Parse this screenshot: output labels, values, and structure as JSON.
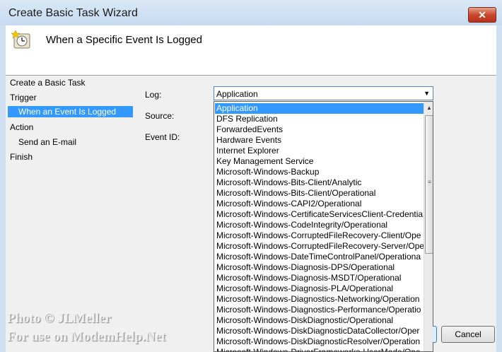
{
  "window": {
    "title": "Create Basic Task Wizard",
    "close_label": "✕"
  },
  "header": {
    "title": "When a Specific Event Is Logged",
    "icon": "scheduled-task-clock-icon"
  },
  "steps": [
    {
      "label": "Create a Basic Task",
      "selected": false,
      "indent": false
    },
    {
      "label": "Trigger",
      "selected": false,
      "indent": false
    },
    {
      "label": "When an Event Is Logged",
      "selected": true,
      "indent": true
    },
    {
      "label": "Action",
      "selected": false,
      "indent": false
    },
    {
      "label": "Send an E-mail",
      "selected": false,
      "indent": true
    },
    {
      "label": "Finish",
      "selected": false,
      "indent": false
    }
  ],
  "form": {
    "log_label": "Log:",
    "source_label": "Source:",
    "event_id_label": "Event ID:",
    "log_value": "Application"
  },
  "dropdown": {
    "selected_index": 0,
    "items": [
      "Application",
      "DFS Replication",
      "ForwardedEvents",
      "Hardware Events",
      "Internet Explorer",
      "Key Management Service",
      "Microsoft-Windows-Backup",
      "Microsoft-Windows-Bits-Client/Analytic",
      "Microsoft-Windows-Bits-Client/Operational",
      "Microsoft-Windows-CAPI2/Operational",
      "Microsoft-Windows-CertificateServicesClient-Credentia",
      "Microsoft-Windows-CodeIntegrity/Operational",
      "Microsoft-Windows-CorruptedFileRecovery-Client/Ope",
      "Microsoft-Windows-CorruptedFileRecovery-Server/Ope",
      "Microsoft-Windows-DateTimeControlPanel/Operationa",
      "Microsoft-Windows-Diagnosis-DPS/Operational",
      "Microsoft-Windows-Diagnosis-MSDT/Operational",
      "Microsoft-Windows-Diagnosis-PLA/Operational",
      "Microsoft-Windows-Diagnostics-Networking/Operation",
      "Microsoft-Windows-Diagnostics-Performance/Operatio",
      "Microsoft-Windows-DiskDiagnostic/Operational",
      "Microsoft-Windows-DiskDiagnosticDataCollector/Oper",
      "Microsoft-Windows-DiskDiagnosticResolver/Operation",
      "Microsoft-Windows-DriverFrameworks-UserMode/Ope"
    ]
  },
  "buttons": {
    "cancel": "Cancel"
  },
  "watermark": {
    "line1": "Photo © JLMeller",
    "line2": "For use on ModemHelp.Net"
  },
  "colors": {
    "selection": "#3399ff",
    "title_bg": "#cfe0f2",
    "close_red": "#c9462b"
  }
}
